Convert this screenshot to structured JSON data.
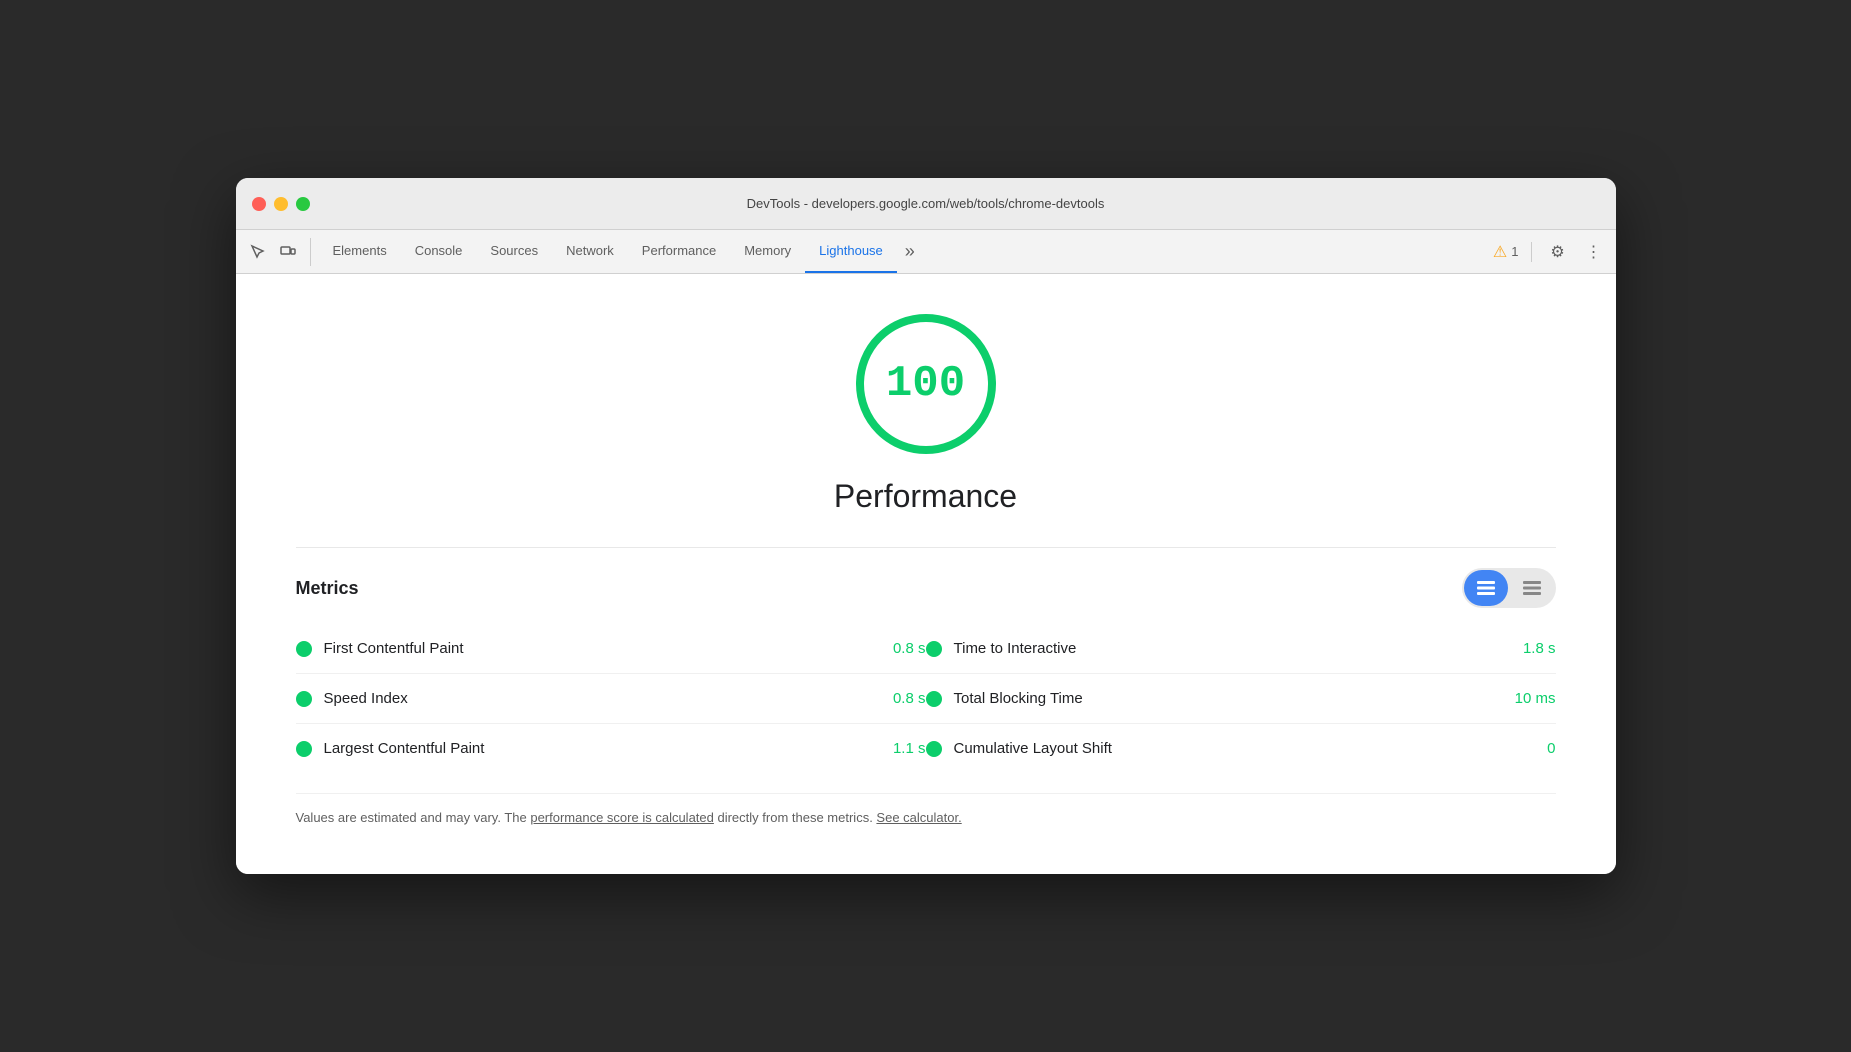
{
  "window": {
    "title": "DevTools - developers.google.com/web/tools/chrome-devtools"
  },
  "toolbar": {
    "tabs": [
      {
        "id": "elements",
        "label": "Elements",
        "active": false
      },
      {
        "id": "console",
        "label": "Console",
        "active": false
      },
      {
        "id": "sources",
        "label": "Sources",
        "active": false
      },
      {
        "id": "network",
        "label": "Network",
        "active": false
      },
      {
        "id": "performance",
        "label": "Performance",
        "active": false
      },
      {
        "id": "memory",
        "label": "Memory",
        "active": false
      },
      {
        "id": "lighthouse",
        "label": "Lighthouse",
        "active": true
      }
    ],
    "more_tabs_label": "»",
    "warning_count": "1",
    "settings_label": "⚙",
    "more_options_label": "⋮"
  },
  "score": {
    "value": "100",
    "label": "Performance"
  },
  "metrics": {
    "title": "Metrics",
    "view_toggle": {
      "list_active": true,
      "chart_active": false
    },
    "rows": [
      {
        "left_name": "First Contentful Paint",
        "left_value": "0.8 s",
        "right_name": "Time to Interactive",
        "right_value": "1.8 s"
      },
      {
        "left_name": "Speed Index",
        "left_value": "0.8 s",
        "right_name": "Total Blocking Time",
        "right_value": "10 ms"
      },
      {
        "left_name": "Largest Contentful Paint",
        "left_value": "1.1 s",
        "right_name": "Cumulative Layout Shift",
        "right_value": "0"
      }
    ]
  },
  "footer": {
    "text_before_link1": "Values are estimated and may vary. The ",
    "link1": "performance score is calculated",
    "text_between": " directly from these metrics. ",
    "link2": "See calculator.",
    "text_after": ""
  },
  "colors": {
    "green": "#0cce6b",
    "blue_active": "#4285f4"
  }
}
